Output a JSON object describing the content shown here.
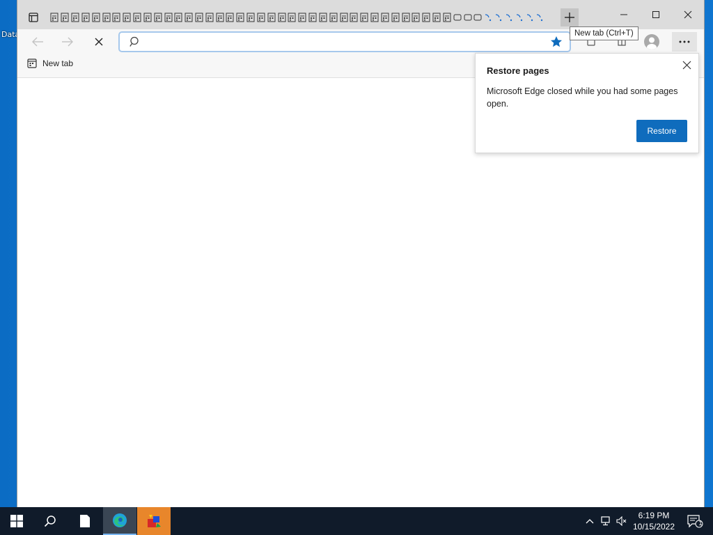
{
  "desktop": {
    "icon_label": "Data"
  },
  "browser": {
    "address": {
      "value": "",
      "placeholder": ""
    },
    "tooltip": "New tab (Ctrl+T)",
    "favorites": [
      {
        "label": "New tab"
      }
    ],
    "restore_popup": {
      "title": "Restore pages",
      "message": "Microsoft Edge closed while you had some pages open.",
      "button_label": "Restore"
    },
    "accent_color": "#0f6cbd"
  },
  "taskbar": {
    "clock_time": "6:19 PM",
    "clock_date": "10/15/2022",
    "notification_count": "1"
  }
}
